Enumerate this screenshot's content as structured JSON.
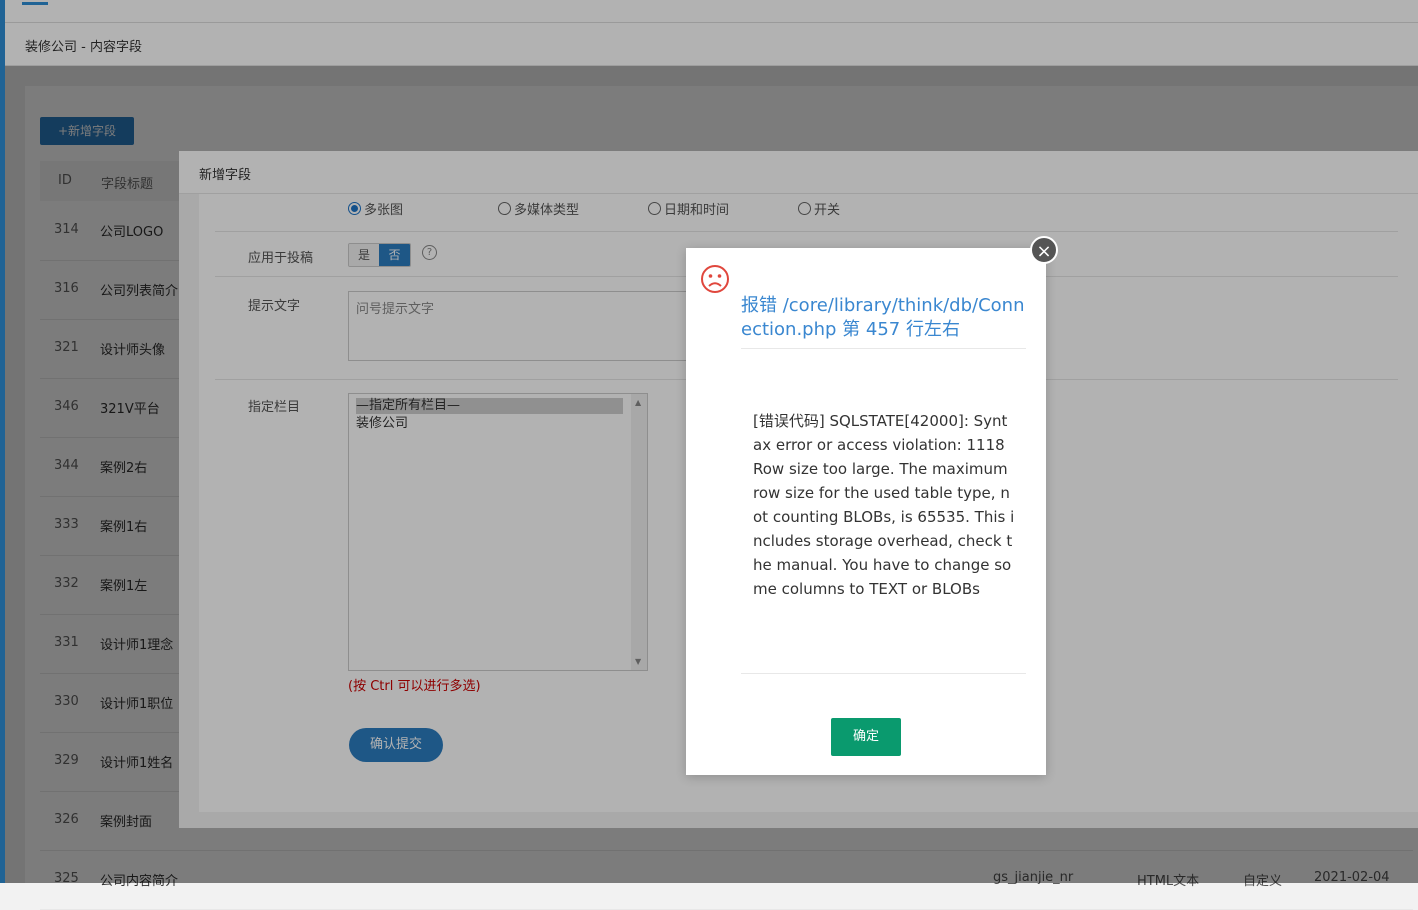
{
  "breadcrumb": "装修公司 - 内容字段",
  "toolbar": {
    "add_label": "+新增字段"
  },
  "table": {
    "headers": {
      "id": "ID",
      "title": "字段标题"
    },
    "rows": [
      {
        "id": "314",
        "title": "公司LOGO"
      },
      {
        "id": "316",
        "title": "公司列表简介"
      },
      {
        "id": "321",
        "title": "设计师头像"
      },
      {
        "id": "346",
        "title": "321V平台"
      },
      {
        "id": "344",
        "title": "案例2右"
      },
      {
        "id": "333",
        "title": "案例1右"
      },
      {
        "id": "332",
        "title": "案例1左"
      },
      {
        "id": "331",
        "title": "设计师1理念"
      },
      {
        "id": "330",
        "title": "设计师1职位"
      },
      {
        "id": "329",
        "title": "设计师1姓名"
      },
      {
        "id": "326",
        "title": "案例封面"
      },
      {
        "id": "325",
        "title": "公司内容简介",
        "field": "gs_jianjie_nr",
        "type": "HTML文本",
        "source": "自定义",
        "date": "2021-02-04"
      }
    ]
  },
  "dialog": {
    "title": "新增字段",
    "radios": [
      "多张图",
      "多媒体类型",
      "日期和时间",
      "开关"
    ],
    "apply_label": "应用于投稿",
    "apply_yes": "是",
    "apply_no": "否",
    "help_icon": "?",
    "tip_label": "提示文字",
    "tip_placeholder": "问号提示文字",
    "column_label": "指定栏目",
    "column_options": [
      "—指定所有栏目—",
      "装修公司"
    ],
    "multi_hint": "(按 Ctrl 可以进行多选)",
    "submit_label": "确认提交"
  },
  "error": {
    "close_glyph": "×",
    "title": "报错 /core/library/think/db/Connection.php 第 457 行左右",
    "message": "[错误代码] SQLSTATE[42000]: Syntax error or access violation: 1118 Row size too large. The maximum row size for the used table type, not counting BLOBs, is 65535. This includes storage overhead, check the manual. You have to change some columns to TEXT or BLOBs",
    "ok_label": "确定",
    "icon": "sad-face-icon",
    "accent": "#3a87d0",
    "ok_color": "#0a9a6e"
  }
}
